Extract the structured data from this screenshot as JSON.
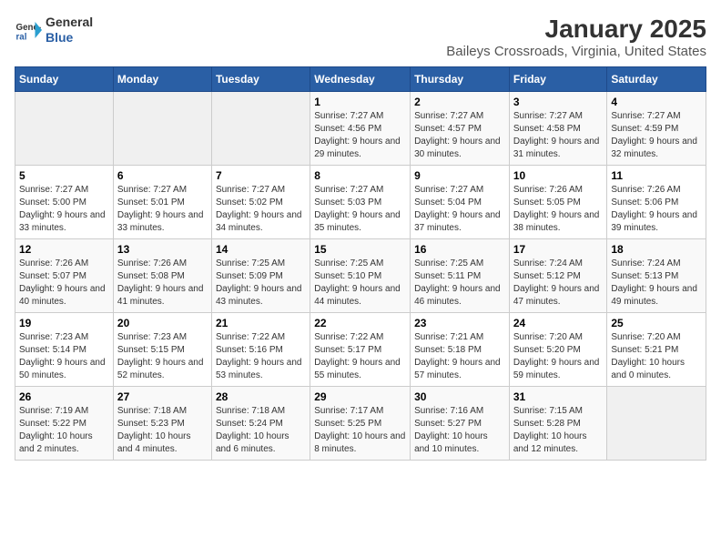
{
  "logo": {
    "line1": "General",
    "line2": "Blue"
  },
  "title": "January 2025",
  "subtitle": "Baileys Crossroads, Virginia, United States",
  "days_of_week": [
    "Sunday",
    "Monday",
    "Tuesday",
    "Wednesday",
    "Thursday",
    "Friday",
    "Saturday"
  ],
  "weeks": [
    [
      {
        "day": "",
        "info": ""
      },
      {
        "day": "",
        "info": ""
      },
      {
        "day": "",
        "info": ""
      },
      {
        "day": "1",
        "info": "Sunrise: 7:27 AM\nSunset: 4:56 PM\nDaylight: 9 hours and 29 minutes."
      },
      {
        "day": "2",
        "info": "Sunrise: 7:27 AM\nSunset: 4:57 PM\nDaylight: 9 hours and 30 minutes."
      },
      {
        "day": "3",
        "info": "Sunrise: 7:27 AM\nSunset: 4:58 PM\nDaylight: 9 hours and 31 minutes."
      },
      {
        "day": "4",
        "info": "Sunrise: 7:27 AM\nSunset: 4:59 PM\nDaylight: 9 hours and 32 minutes."
      }
    ],
    [
      {
        "day": "5",
        "info": "Sunrise: 7:27 AM\nSunset: 5:00 PM\nDaylight: 9 hours and 33 minutes."
      },
      {
        "day": "6",
        "info": "Sunrise: 7:27 AM\nSunset: 5:01 PM\nDaylight: 9 hours and 33 minutes."
      },
      {
        "day": "7",
        "info": "Sunrise: 7:27 AM\nSunset: 5:02 PM\nDaylight: 9 hours and 34 minutes."
      },
      {
        "day": "8",
        "info": "Sunrise: 7:27 AM\nSunset: 5:03 PM\nDaylight: 9 hours and 35 minutes."
      },
      {
        "day": "9",
        "info": "Sunrise: 7:27 AM\nSunset: 5:04 PM\nDaylight: 9 hours and 37 minutes."
      },
      {
        "day": "10",
        "info": "Sunrise: 7:26 AM\nSunset: 5:05 PM\nDaylight: 9 hours and 38 minutes."
      },
      {
        "day": "11",
        "info": "Sunrise: 7:26 AM\nSunset: 5:06 PM\nDaylight: 9 hours and 39 minutes."
      }
    ],
    [
      {
        "day": "12",
        "info": "Sunrise: 7:26 AM\nSunset: 5:07 PM\nDaylight: 9 hours and 40 minutes."
      },
      {
        "day": "13",
        "info": "Sunrise: 7:26 AM\nSunset: 5:08 PM\nDaylight: 9 hours and 41 minutes."
      },
      {
        "day": "14",
        "info": "Sunrise: 7:25 AM\nSunset: 5:09 PM\nDaylight: 9 hours and 43 minutes."
      },
      {
        "day": "15",
        "info": "Sunrise: 7:25 AM\nSunset: 5:10 PM\nDaylight: 9 hours and 44 minutes."
      },
      {
        "day": "16",
        "info": "Sunrise: 7:25 AM\nSunset: 5:11 PM\nDaylight: 9 hours and 46 minutes."
      },
      {
        "day": "17",
        "info": "Sunrise: 7:24 AM\nSunset: 5:12 PM\nDaylight: 9 hours and 47 minutes."
      },
      {
        "day": "18",
        "info": "Sunrise: 7:24 AM\nSunset: 5:13 PM\nDaylight: 9 hours and 49 minutes."
      }
    ],
    [
      {
        "day": "19",
        "info": "Sunrise: 7:23 AM\nSunset: 5:14 PM\nDaylight: 9 hours and 50 minutes."
      },
      {
        "day": "20",
        "info": "Sunrise: 7:23 AM\nSunset: 5:15 PM\nDaylight: 9 hours and 52 minutes."
      },
      {
        "day": "21",
        "info": "Sunrise: 7:22 AM\nSunset: 5:16 PM\nDaylight: 9 hours and 53 minutes."
      },
      {
        "day": "22",
        "info": "Sunrise: 7:22 AM\nSunset: 5:17 PM\nDaylight: 9 hours and 55 minutes."
      },
      {
        "day": "23",
        "info": "Sunrise: 7:21 AM\nSunset: 5:18 PM\nDaylight: 9 hours and 57 minutes."
      },
      {
        "day": "24",
        "info": "Sunrise: 7:20 AM\nSunset: 5:20 PM\nDaylight: 9 hours and 59 minutes."
      },
      {
        "day": "25",
        "info": "Sunrise: 7:20 AM\nSunset: 5:21 PM\nDaylight: 10 hours and 0 minutes."
      }
    ],
    [
      {
        "day": "26",
        "info": "Sunrise: 7:19 AM\nSunset: 5:22 PM\nDaylight: 10 hours and 2 minutes."
      },
      {
        "day": "27",
        "info": "Sunrise: 7:18 AM\nSunset: 5:23 PM\nDaylight: 10 hours and 4 minutes."
      },
      {
        "day": "28",
        "info": "Sunrise: 7:18 AM\nSunset: 5:24 PM\nDaylight: 10 hours and 6 minutes."
      },
      {
        "day": "29",
        "info": "Sunrise: 7:17 AM\nSunset: 5:25 PM\nDaylight: 10 hours and 8 minutes."
      },
      {
        "day": "30",
        "info": "Sunrise: 7:16 AM\nSunset: 5:27 PM\nDaylight: 10 hours and 10 minutes."
      },
      {
        "day": "31",
        "info": "Sunrise: 7:15 AM\nSunset: 5:28 PM\nDaylight: 10 hours and 12 minutes."
      },
      {
        "day": "",
        "info": ""
      }
    ]
  ]
}
